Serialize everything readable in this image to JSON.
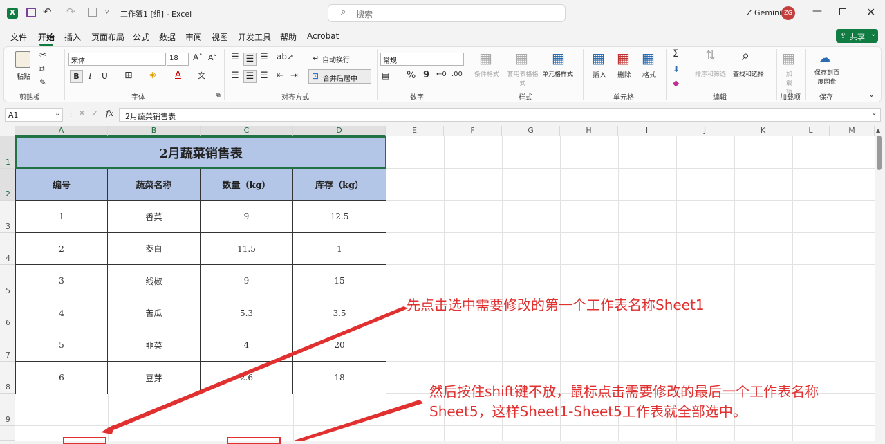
{
  "titlebar": {
    "doc_title": "工作簿1 [组] - Excel",
    "search_placeholder": "搜索",
    "user_name": "Z Gemini",
    "user_initials": "ZG"
  },
  "menu": {
    "tabs": [
      "文件",
      "开始",
      "插入",
      "页面布局",
      "公式",
      "数据",
      "审阅",
      "视图",
      "开发工具",
      "帮助",
      "Acrobat"
    ],
    "active": "开始",
    "share": "共享"
  },
  "ribbon": {
    "clipboard": {
      "paste": "粘贴",
      "group": "剪贴板"
    },
    "font": {
      "name": "宋体",
      "size": "18",
      "bold": "B",
      "italic": "I",
      "underline": "U",
      "group": "字体"
    },
    "alignment": {
      "wrap": "自动换行",
      "merge": "合并后居中",
      "group": "对齐方式"
    },
    "number": {
      "format": "常规",
      "percent": "%",
      "comma": "9",
      "group": "数字"
    },
    "styles": {
      "conditional": "条件格式",
      "table": "套用表格格式",
      "cell_styles": "单元格样式",
      "group": "样式"
    },
    "cells": {
      "insert": "插入",
      "delete": "删除",
      "format": "格式",
      "group": "单元格"
    },
    "editing": {
      "sort": "排序和筛选",
      "find": "查找和选择",
      "group": "编辑"
    },
    "addins": {
      "label": "加载项",
      "group": "加载项"
    },
    "save": {
      "label": "保存到百度网盘",
      "group": "保存"
    }
  },
  "formula_bar": {
    "name_box": "A1",
    "fx": "fx",
    "value": "2月蔬菜销售表"
  },
  "sheet": {
    "columns": [
      "A",
      "B",
      "C",
      "D",
      "E",
      "F",
      "G",
      "H",
      "I",
      "J",
      "K",
      "L",
      "M"
    ],
    "rows": [
      "1",
      "2",
      "3",
      "4",
      "5",
      "6",
      "7",
      "8",
      "9"
    ],
    "title": "2月蔬菜销售表",
    "headers": [
      "编号",
      "蔬菜名称",
      "数量（kg）",
      "库存（kg）"
    ],
    "data": [
      [
        "1",
        "香菜",
        "9",
        "12.5"
      ],
      [
        "2",
        "茭白",
        "11.5",
        "1"
      ],
      [
        "3",
        "线椒",
        "9",
        "15"
      ],
      [
        "4",
        "苦瓜",
        "5.3",
        "3.5"
      ],
      [
        "5",
        "韭菜",
        "4",
        "20"
      ],
      [
        "6",
        "豆芽",
        "2.6",
        "18"
      ]
    ]
  },
  "annotations": {
    "note1": "先点击选中需要修改的第一个工作表名称Sheet1",
    "note2_line1": "然后按住shift键不放，鼠标点击需要修改的最后一个工作表名称",
    "note2_line2": "Sheet5，这样Sheet1-Sheet5工作表就全部选中。",
    "color": "#e03030"
  }
}
